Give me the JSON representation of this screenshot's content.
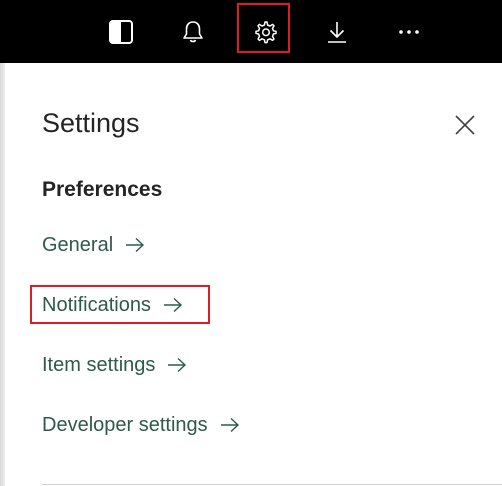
{
  "topbar": {
    "icons": [
      "panel-toggle-icon",
      "bell-icon",
      "gear-icon",
      "download-icon",
      "more-icon"
    ],
    "background": "#000000",
    "highlight_color": "#e01b24"
  },
  "settings_panel": {
    "title": "Settings",
    "section_title": "Preferences",
    "links": [
      {
        "label": "General"
      },
      {
        "label": "Notifications"
      },
      {
        "label": "Item settings"
      },
      {
        "label": "Developer settings"
      }
    ],
    "link_color": "#2e5a4a"
  }
}
